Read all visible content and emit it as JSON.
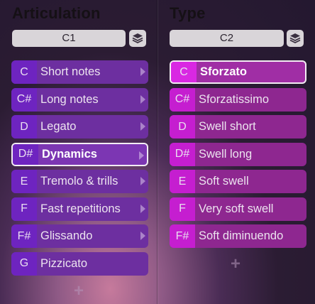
{
  "articulation": {
    "title": "Articulation",
    "field_value": "C1",
    "items": [
      {
        "key": "C",
        "label": "Short notes"
      },
      {
        "key": "C#",
        "label": "Long notes"
      },
      {
        "key": "D",
        "label": "Legato"
      },
      {
        "key": "D#",
        "label": "Dynamics"
      },
      {
        "key": "E",
        "label": "Tremolo & trills"
      },
      {
        "key": "F",
        "label": "Fast repetitions"
      },
      {
        "key": "F#",
        "label": "Glissando"
      },
      {
        "key": "G",
        "label": "Pizzicato"
      }
    ],
    "selected_label": "Dynamics",
    "add_symbol": "+"
  },
  "type": {
    "title": "Type",
    "field_value": "C2",
    "items": [
      {
        "key": "C",
        "label": "Sforzato"
      },
      {
        "key": "C#",
        "label": "Sforzatissimo"
      },
      {
        "key": "D",
        "label": "Swell short"
      },
      {
        "key": "D#",
        "label": "Swell long"
      },
      {
        "key": "E",
        "label": "Soft swell"
      },
      {
        "key": "F",
        "label": "Very soft swell"
      },
      {
        "key": "F#",
        "label": "Soft diminuendo"
      }
    ],
    "selected_label": "Sforzato",
    "add_symbol": "+"
  },
  "icons": {
    "layers_button": "layers-icon",
    "submenu_arrow": "chevron-right-icon",
    "add": "plus-icon"
  },
  "colors": {
    "articulation_key": "#6e24c0",
    "articulation_item": "#6d2fa0",
    "type_key": "#c51ed0",
    "type_item": "#8e2790",
    "selected_border": "#f3ecf4"
  }
}
